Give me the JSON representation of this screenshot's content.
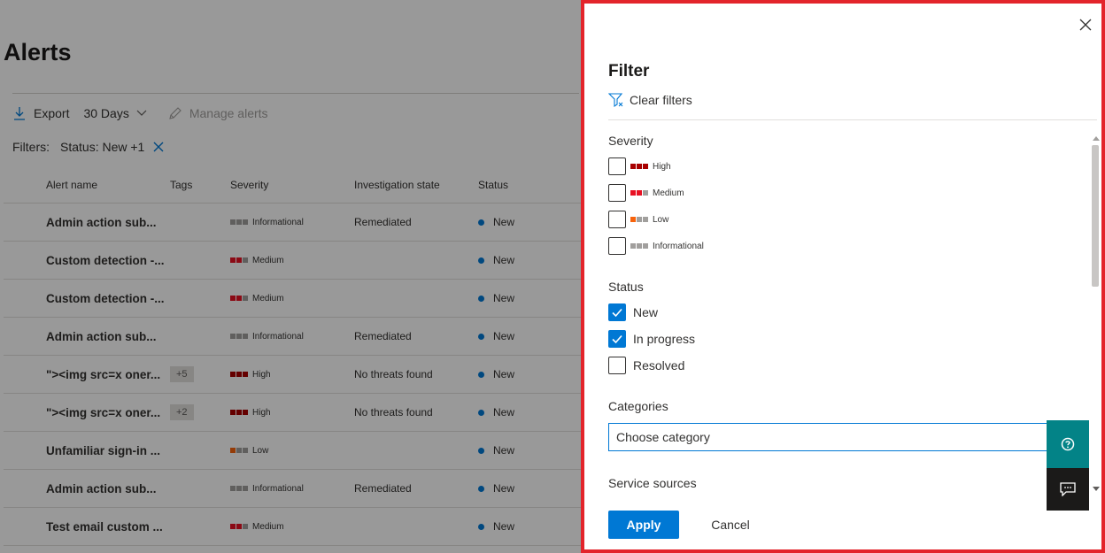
{
  "page": {
    "title": "Alerts",
    "toolbar": {
      "export_label": "Export",
      "range_label": "30 Days",
      "manage_label": "Manage alerts"
    },
    "filters": {
      "label": "Filters:",
      "value": "Status: New +1"
    },
    "table": {
      "headers": [
        "Alert name",
        "Tags",
        "Severity",
        "Investigation state",
        "Status"
      ],
      "rows": [
        {
          "name": "Admin action sub...",
          "tag": "",
          "severity": "Informational",
          "investigation": "Remediated",
          "status": "New"
        },
        {
          "name": "Custom detection -...",
          "tag": "",
          "severity": "Medium",
          "investigation": "",
          "status": "New"
        },
        {
          "name": "Custom detection -...",
          "tag": "",
          "severity": "Medium",
          "investigation": "",
          "status": "New"
        },
        {
          "name": "Admin action sub...",
          "tag": "",
          "severity": "Informational",
          "investigation": "Remediated",
          "status": "New"
        },
        {
          "name": "\"><img src=x oner...",
          "tag": "+5",
          "severity": "High",
          "investigation": "No threats found",
          "status": "New"
        },
        {
          "name": "\"><img src=x oner...",
          "tag": "+2",
          "severity": "High",
          "investigation": "No threats found",
          "status": "New"
        },
        {
          "name": "Unfamiliar sign-in ...",
          "tag": "",
          "severity": "Low",
          "investigation": "",
          "status": "New"
        },
        {
          "name": "Admin action sub...",
          "tag": "",
          "severity": "Informational",
          "investigation": "Remediated",
          "status": "New"
        },
        {
          "name": "Test email custom ...",
          "tag": "",
          "severity": "Medium",
          "investigation": "",
          "status": "New"
        }
      ]
    }
  },
  "severity_colors": {
    "High": [
      "#a80000",
      "#a80000",
      "#a80000"
    ],
    "Medium": [
      "#e81123",
      "#e81123",
      "#a19f9d"
    ],
    "Low": [
      "#f7630c",
      "#a19f9d",
      "#a19f9d"
    ],
    "Informational": [
      "#a19f9d",
      "#a19f9d",
      "#a19f9d"
    ]
  },
  "panel": {
    "title": "Filter",
    "clear_filters": "Clear filters",
    "severity_heading": "Severity",
    "severity_options": [
      {
        "label": "High",
        "checked": false
      },
      {
        "label": "Medium",
        "checked": false
      },
      {
        "label": "Low",
        "checked": false
      },
      {
        "label": "Informational",
        "checked": false
      }
    ],
    "status_heading": "Status",
    "status_options": [
      {
        "label": "New",
        "checked": true
      },
      {
        "label": "In progress",
        "checked": true
      },
      {
        "label": "Resolved",
        "checked": false
      }
    ],
    "categories_heading": "Categories",
    "categories_placeholder": "Choose category",
    "service_sources_heading": "Service sources",
    "apply_label": "Apply",
    "cancel_label": "Cancel"
  },
  "colors": {
    "accent": "#0078d4",
    "panel_border": "#e3242b",
    "help_button": "#038387",
    "chat_button": "#1b1a19"
  }
}
